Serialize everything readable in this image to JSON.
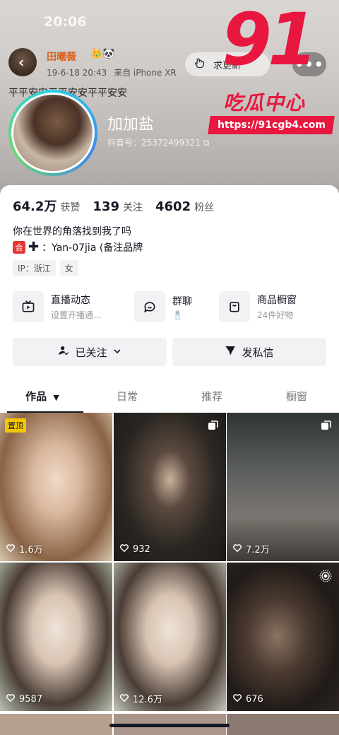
{
  "status_bar": {
    "time": "20:06"
  },
  "post": {
    "poster_name": "田曦薇",
    "badges": "👑🐼",
    "date": "19-6-18 20:43",
    "source": "来自 iPhone XR",
    "text": "平平安安平平安安平平安安",
    "follow_label": "求更新",
    "more_label": "•••"
  },
  "watermark": {
    "number": "91",
    "chinese": "吃瓜中心",
    "url": "https://91cgb4.com"
  },
  "profile": {
    "display_name": "加加盐",
    "douyin_id": "抖音号：25372499321"
  },
  "stats": [
    {
      "value": "64.2万",
      "label": "获赞"
    },
    {
      "value": "139",
      "label": "关注"
    },
    {
      "value": "4602",
      "label": "粉丝"
    }
  ],
  "bio": {
    "line1": "你在世界的角落找到我了吗",
    "badge": "合",
    "plus": "✚",
    "line2": "：Yan-07jia (备注品牌"
  },
  "tags": [
    "IP：浙江",
    "女"
  ],
  "shortcuts": [
    {
      "title": "直播动态",
      "sub": "设置开播通…",
      "icon": "tv-icon"
    },
    {
      "title": "群聊",
      "sub": "🧂",
      "icon": "chat-icon"
    },
    {
      "title": "商品橱窗",
      "sub": "24件好物",
      "icon": "shop-icon"
    }
  ],
  "buttons": {
    "followed": "已关注",
    "message": "发私信"
  },
  "tabs": [
    "作品",
    "日常",
    "推荐",
    "橱窗"
  ],
  "works": [
    {
      "likes": "1.6万",
      "pinned": "置顶",
      "bg": "#d8b79e"
    },
    {
      "likes": "932",
      "bg": "#2a2622"
    },
    {
      "likes": "7.2万",
      "bg": "#5d6060"
    },
    {
      "likes": "9587",
      "bg": "#b9c2b3"
    },
    {
      "likes": "12.6万",
      "bg": "#c4c8bd"
    },
    {
      "likes": "676",
      "bg": "#332a24"
    }
  ]
}
